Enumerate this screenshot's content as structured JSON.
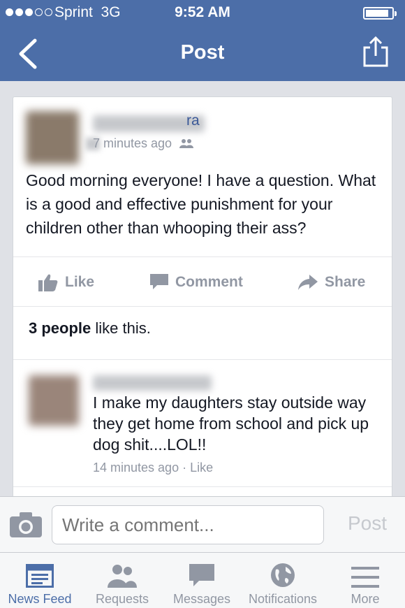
{
  "status_bar": {
    "carrier": "Sprint",
    "network": "3G",
    "time": "9:52 AM"
  },
  "nav": {
    "title": "Post"
  },
  "post": {
    "author_visible": "ra",
    "time": "7 minutes ago",
    "text": "Good morning everyone! I have a question. What is a good and effective punishment for your children other than whooping their ass?",
    "actions": {
      "like": "Like",
      "comment": "Comment",
      "share": "Share"
    },
    "likes": {
      "count": "3 people",
      "suffix": " like this."
    }
  },
  "comment": {
    "text": "I make my daughters stay outside way they get home from school and pick up dog shit....LOL!!",
    "time": "14 minutes ago",
    "separator": " · ",
    "like": "Like"
  },
  "compose": {
    "placeholder": "Write a comment...",
    "post_label": "Post"
  },
  "tabs": [
    {
      "label": "News Feed",
      "icon": "news-feed-icon",
      "active": true
    },
    {
      "label": "Requests",
      "icon": "friend-requests-icon"
    },
    {
      "label": "Messages",
      "icon": "messages-icon"
    },
    {
      "label": "Notifications",
      "icon": "globe-icon"
    },
    {
      "label": "More",
      "icon": "menu-icon"
    }
  ],
  "colors": {
    "brand": "#4c6ea8",
    "muted": "#9197a3",
    "text": "#141823"
  }
}
